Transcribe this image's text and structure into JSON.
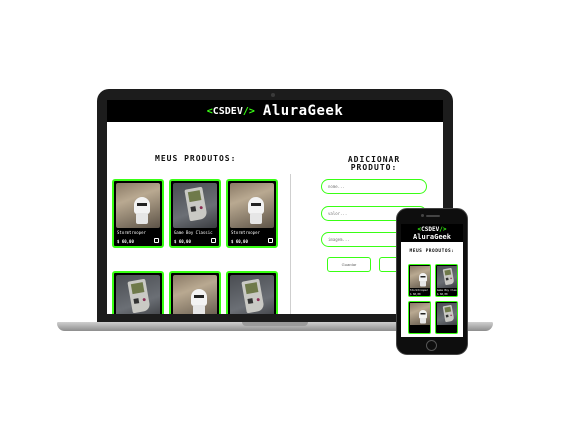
{
  "site": {
    "logo_open": "<",
    "logo_text": "CSDEV",
    "logo_close": "/>",
    "name": "AluraGeek"
  },
  "products_section": {
    "title": "MEUS PRODUTOS:",
    "items": [
      {
        "name": "Stormtrooper",
        "price": "$ 60,00",
        "image": "stormtrooper"
      },
      {
        "name": "Game Boy Classic",
        "price": "$ 60,00",
        "image": "gameboy"
      },
      {
        "name": "Stormtrooper",
        "price": "$ 60,00",
        "image": "stormtrooper"
      },
      {
        "name": "",
        "price": "",
        "image": "gameboy"
      },
      {
        "name": "",
        "price": "",
        "image": "stormtrooper"
      },
      {
        "name": "",
        "price": "",
        "image": "gameboy"
      }
    ]
  },
  "add_section": {
    "title_line1": "ADICIONAR",
    "title_line2": "PRODUTO:",
    "fields": [
      {
        "placeholder": "nome..."
      },
      {
        "placeholder": "valor..."
      },
      {
        "placeholder": "imagem..."
      }
    ],
    "save_label": "Guardar",
    "clear_label": ""
  },
  "mobile": {
    "products_title": "MEUS PRODUTOS:",
    "items": [
      {
        "name": "Stormtrooper",
        "price": "$ 60,00",
        "image": "stormtrooper"
      },
      {
        "name": "Game Boy Classic",
        "price": "$ 60,00",
        "image": "gameboy"
      },
      {
        "name": "",
        "price": "",
        "image": "stormtrooper"
      },
      {
        "name": "",
        "price": "",
        "image": "gameboy"
      }
    ]
  },
  "colors": {
    "accent": "#39ff14",
    "header_bg": "#000000",
    "card_bg": "#000000"
  }
}
